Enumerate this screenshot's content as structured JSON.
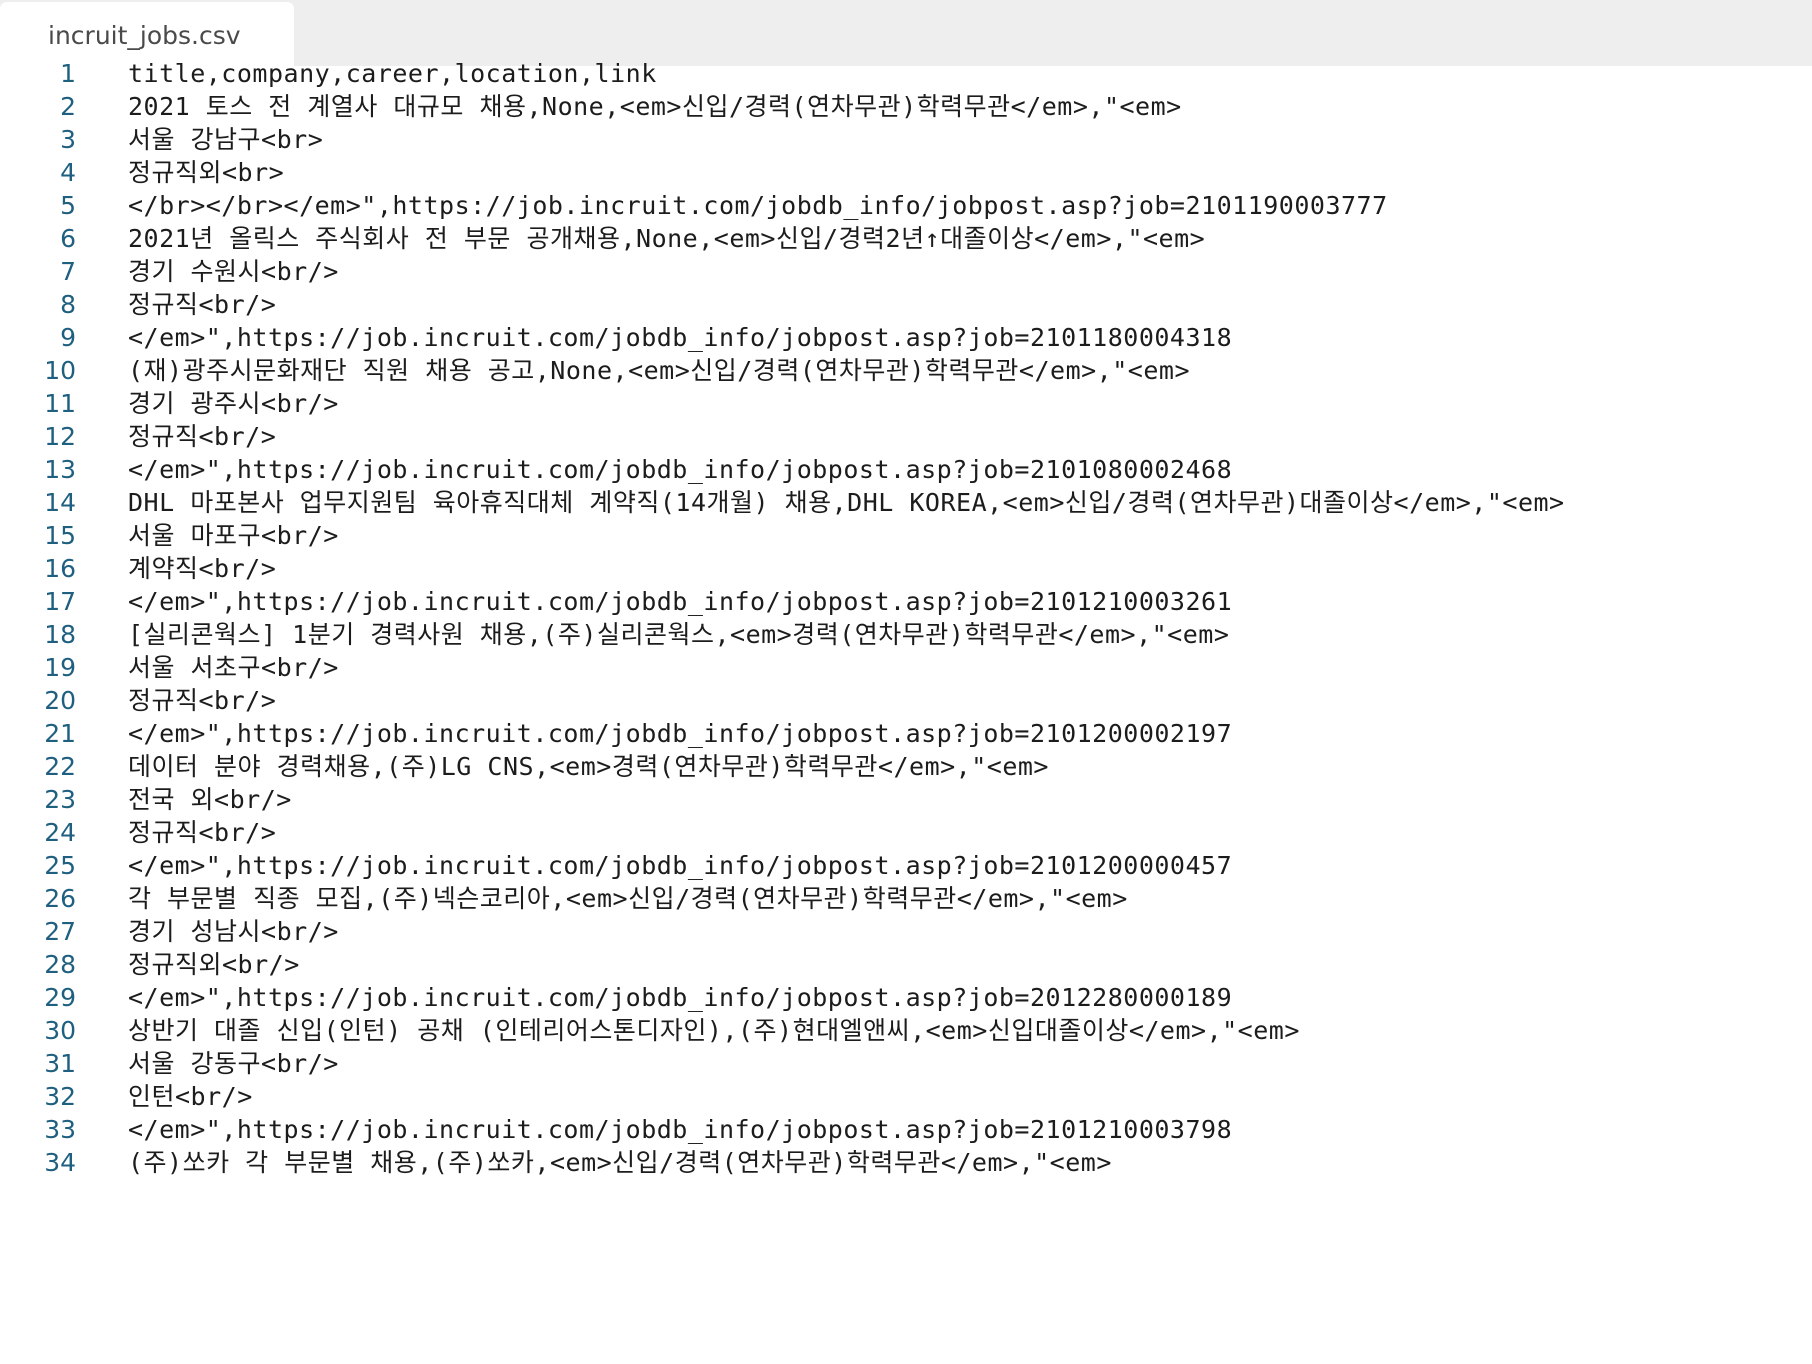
{
  "tab": {
    "filename": "incruit_jobs.csv"
  },
  "lines": [
    "title,company,career,location,link",
    "2021 토스 전 계열사 대규모 채용,None,<em>신입/경력(연차무관)학력무관</em>,\"<em>",
    "서울 강남구<br>",
    "정규직외<br>",
    "</br></br></em>\",https://job.incruit.com/jobdb_info/jobpost.asp?job=2101190003777",
    "2021년 올릭스 주식회사 전 부문 공개채용,None,<em>신입/경력2년↑대졸이상</em>,\"<em>",
    "경기 수원시<br/>",
    "정규직<br/>",
    "</em>\",https://job.incruit.com/jobdb_info/jobpost.asp?job=2101180004318",
    "(재)광주시문화재단 직원 채용 공고,None,<em>신입/경력(연차무관)학력무관</em>,\"<em>",
    "경기 광주시<br/>",
    "정규직<br/>",
    "</em>\",https://job.incruit.com/jobdb_info/jobpost.asp?job=2101080002468",
    "DHL 마포본사 업무지원팀 육아휴직대체 계약직(14개월) 채용,DHL KOREA,<em>신입/경력(연차무관)대졸이상</em>,\"<em>",
    "서울 마포구<br/>",
    "계약직<br/>",
    "</em>\",https://job.incruit.com/jobdb_info/jobpost.asp?job=2101210003261",
    "[실리콘웍스] 1분기 경력사원 채용,(주)실리콘웍스,<em>경력(연차무관)학력무관</em>,\"<em>",
    "서울 서초구<br/>",
    "정규직<br/>",
    "</em>\",https://job.incruit.com/jobdb_info/jobpost.asp?job=2101200002197",
    "데이터 분야 경력채용,(주)LG CNS,<em>경력(연차무관)학력무관</em>,\"<em>",
    "전국 외<br/>",
    "정규직<br/>",
    "</em>\",https://job.incruit.com/jobdb_info/jobpost.asp?job=2101200000457",
    "각 부문별 직종 모집,(주)넥슨코리아,<em>신입/경력(연차무관)학력무관</em>,\"<em>",
    "경기 성남시<br/>",
    "정규직외<br/>",
    "</em>\",https://job.incruit.com/jobdb_info/jobpost.asp?job=2012280000189",
    "상반기 대졸 신입(인턴) 공채 (인테리어스톤디자인),(주)현대엘앤씨,<em>신입대졸이상</em>,\"<em>",
    "서울 강동구<br/>",
    "인턴<br/>",
    "</em>\",https://job.incruit.com/jobdb_info/jobpost.asp?job=2101210003798",
    "(주)쏘카 각 부문별 채용,(주)쏘카,<em>신입/경력(연차무관)학력무관</em>,\"<em>"
  ],
  "line_numbers": [
    "1",
    "2",
    "3",
    "4",
    "5",
    "6",
    "7",
    "8",
    "9",
    "10",
    "11",
    "12",
    "13",
    "14",
    "15",
    "16",
    "17",
    "18",
    "19",
    "20",
    "21",
    "22",
    "23",
    "24",
    "25",
    "26",
    "27",
    "28",
    "29",
    "30",
    "31",
    "32",
    "33",
    "34"
  ],
  "colors": {
    "line_number": "#1f5f80",
    "text": "#1c1c1c",
    "tabbar": "#eeeeee"
  }
}
